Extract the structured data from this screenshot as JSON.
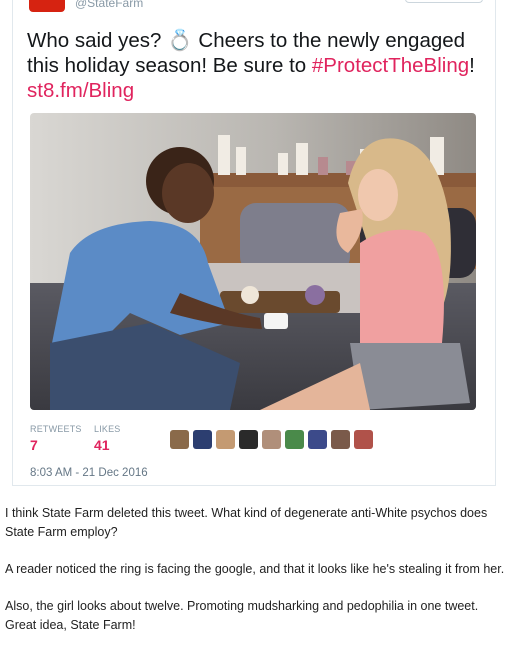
{
  "tweet": {
    "handle": "@StateFarm",
    "text_part1": "Who said yes? ",
    "ring_emoji": "💍",
    "text_part2": " Cheers to the newly engaged this holiday season! Be sure to ",
    "hashtag": "#ProtectTheBling",
    "text_part3": "!",
    "link": "st8.fm/Bling",
    "retweets_label": "RETWEETS",
    "retweets_count": "7",
    "likes_label": "LIKES",
    "likes_count": "41",
    "timestamp": "8:03 AM - 21 Dec 2016",
    "accent_color": "#e0245e",
    "brand_color": "#d62311"
  },
  "article": {
    "paragraphs": [
      "I think State Farm deleted this tweet. What kind of degenerate anti-White psychos does State Farm employ?",
      "A reader noticed the ring is facing the google, and that it looks like he's stealing it from her.",
      "Also, the girl looks about twelve. Promoting mudsharking and pedophilia in one tweet. Great idea, State Farm!"
    ]
  }
}
